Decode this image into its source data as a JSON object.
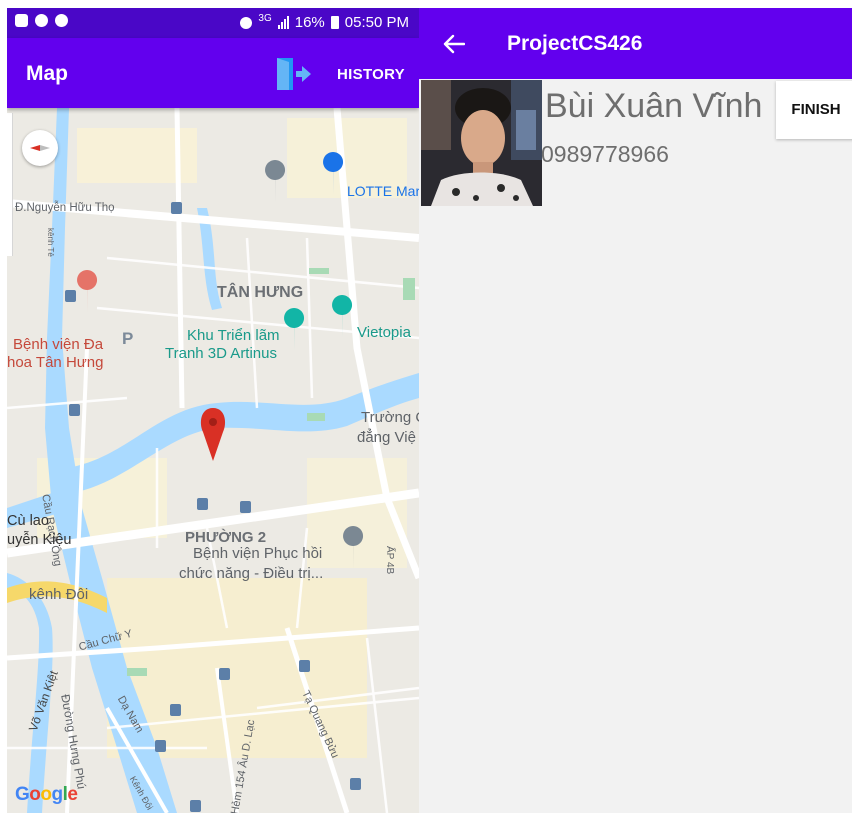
{
  "status_bar": {
    "network": "3G",
    "battery": "16%",
    "time": "05:50 PM"
  },
  "map_screen": {
    "title": "Map",
    "history_label": "HISTORY",
    "icons": {
      "logout": "logout-door-icon",
      "compass": "compass-icon",
      "pin": "location-pin-icon"
    },
    "labels": {
      "nguyen_huu_tho": "Đ.Nguyễn Hữu Thọ",
      "lotte": "LOTTE Mar",
      "tan_hung": "TÂN HƯNG",
      "hospital_1": "Bệnh viện Đa",
      "hospital_2": "hoa Tân Hưng",
      "khu_trien_lam_1": "Khu Triển lãm",
      "khu_trien_lam_2": "Tranh 3D Artinus",
      "vietopia": "Vietopia",
      "truong_1": "Trường C",
      "truong_2": "đẳng Việ",
      "cau_rach_ong": "Cầu Rạch Ông",
      "cu_lao_1": "Cù lao",
      "cu_lao_2": "uyễn Kiệu",
      "phuong_2": "PHƯỜNG 2",
      "benh_vien_ph_1": "Bệnh viện Phục hồi",
      "benh_vien_ph_2": "chức năng - Điều trị...",
      "ap_4b": "ẤP 4B",
      "kenh_doi": "kênh Đôi",
      "cau_chu_y": "Cầu Chữ Y",
      "vo_van_kiet": "Võ Văn Kiệt",
      "duong_hung_phu": "Đường Hưng Phú",
      "da_nam": "Dạ Nam",
      "hem_154": "Hẻm 154 Âu D. Lạc",
      "ta_quang_buu": "Tạ Quang Bửu",
      "kenh_te": "kênh Tẻ",
      "kenh_doi_small": "Kênh Đôi",
      "parking": "P"
    },
    "google": [
      "G",
      "o",
      "o",
      "g",
      "l",
      "e"
    ]
  },
  "detail_screen": {
    "title": "ProjectCS426",
    "user_name": "Bùi Xuân Vĩnh",
    "phone": "0989778966",
    "finish_label": "FINISH"
  },
  "colors": {
    "primary": "#6200ee",
    "status_bar": "#4a07c7",
    "map_bg": "#eceae4",
    "water": "#aadaff",
    "pin": "#d93025"
  }
}
